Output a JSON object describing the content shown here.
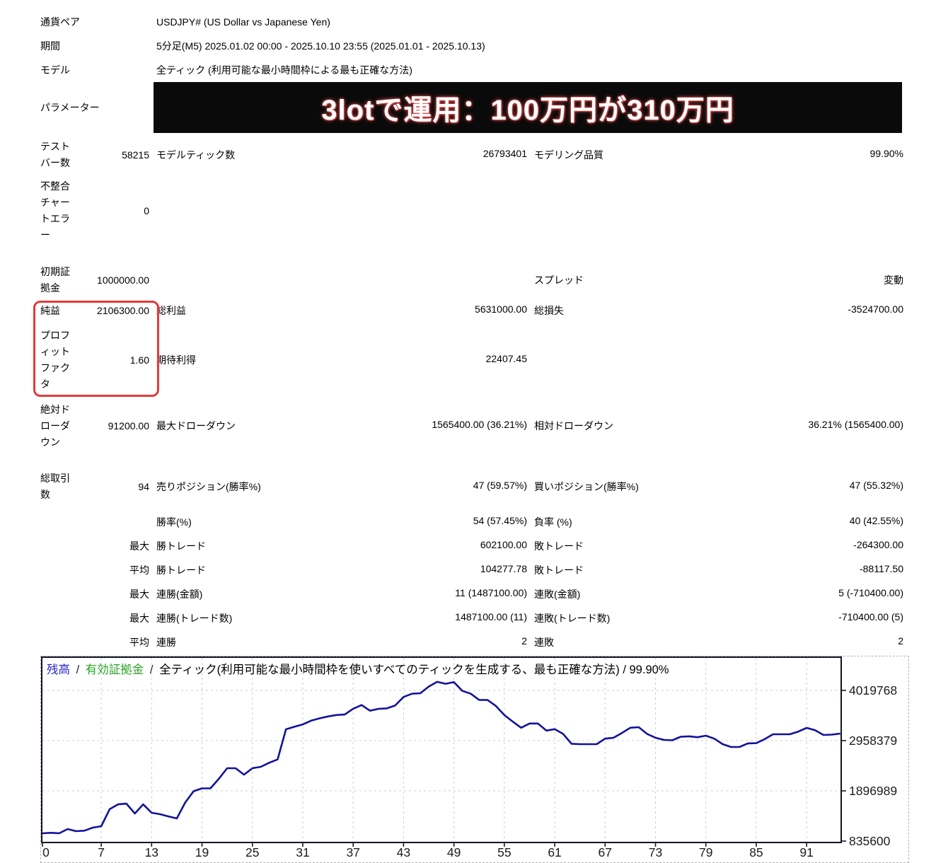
{
  "report": {
    "info_rows": [
      {
        "label": "通貨ペア",
        "value": "USDJPY# (US Dollar vs Japanese Yen)"
      },
      {
        "label": "期間",
        "value": "5分足(M5) 2025.01.02 00:00 - 2025.10.10 23:55 (2025.01.01 - 2025.10.13)"
      },
      {
        "label": "モデル",
        "value": "全ティック (利用可能な最小時間枠による最も正確な方法)"
      }
    ],
    "parameter_label": "パラメーター",
    "banner_text": "3lotで運用：100万円が310万円",
    "stat_rows": [
      {
        "c1": "テストバー数",
        "c2": "58215",
        "c3": "モデルティック数",
        "c4": "26793401",
        "c5": "モデリング品質",
        "c6": "99.90%"
      },
      {
        "c1": "不整合チャートエラー",
        "c2": "0",
        "c3": "",
        "c4": "",
        "c5": "",
        "c6": ""
      },
      {
        "c1": "初期証拠金",
        "c2": "1000000.00",
        "c3": "",
        "c4": "",
        "c5": "スプレッド",
        "c6": "変動"
      },
      {
        "c1": "純益",
        "c2": "2106300.00",
        "c3": "総利益",
        "c4": "5631000.00",
        "c5": "総損失",
        "c6": "-3524700.00"
      },
      {
        "c1": "プロフィットファクタ",
        "c2": "1.60",
        "c3": "期待利得",
        "c4": "22407.45",
        "c5": "",
        "c6": ""
      },
      {
        "c1": "絶対ドローダウン",
        "c2": "91200.00",
        "c3": "最大ドローダウン",
        "c4": "1565400.00 (36.21%)",
        "c5": "相対ドローダウン",
        "c6": "36.21% (1565400.00)"
      },
      {
        "c1": "総取引数",
        "c2": "94",
        "c3": "売りポジション(勝率%)",
        "c4": "47 (59.57%)",
        "c5": "買いポジション(勝率%)",
        "c6": "47 (55.32%)"
      },
      {
        "c1": "",
        "c2": "",
        "c3": "勝率(%)",
        "c4": "54 (57.45%)",
        "c5": "負率 (%)",
        "c6": "40 (42.55%)"
      },
      {
        "c1": "",
        "c2": "最大",
        "c3": "勝トレード",
        "c4": "602100.00",
        "c5": "敗トレード",
        "c6": "-264300.00"
      },
      {
        "c1": "",
        "c2": "平均",
        "c3": "勝トレード",
        "c4": "104277.78",
        "c5": "敗トレード",
        "c6": "-88117.50"
      },
      {
        "c1": "",
        "c2": "最大",
        "c3": "連勝(金額)",
        "c4": "11 (1487100.00)",
        "c5": "連敗(金額)",
        "c6": "5 (-710400.00)"
      },
      {
        "c1": "",
        "c2": "最大",
        "c3": "連勝(トレード数)",
        "c4": "1487100.00 (11)",
        "c5": "連敗(トレード数)",
        "c6": "-710400.00 (5)"
      },
      {
        "c1": "",
        "c2": "平均",
        "c3": "連勝",
        "c4": "2",
        "c5": "連敗",
        "c6": "2"
      }
    ]
  },
  "chart_data": {
    "type": "line",
    "legend_balance": "残高",
    "legend_equity": "有効証拠金",
    "separator": "/",
    "description": "全ティック(利用可能な最小時間枠を使いすべてのティックを生成する、最も正確な方法) / 99.90%",
    "xlabel": "",
    "ylabel": "",
    "x_ticks": [
      0,
      7,
      13,
      19,
      25,
      31,
      37,
      43,
      49,
      55,
      61,
      67,
      73,
      79,
      85,
      91
    ],
    "y_ticks": [
      4019768,
      2958379,
      1896989,
      835600
    ],
    "xlim": [
      0,
      95
    ],
    "ylim": [
      581000,
      4662000
    ],
    "grid": true,
    "legend_position": "top-left",
    "series": [
      {
        "name": "残高",
        "values": [
          1000000,
          1010000,
          1000000,
          1090000,
          1045000,
          1055000,
          1120000,
          1150000,
          1510000,
          1612000,
          1627000,
          1418000,
          1612000,
          1433000,
          1403000,
          1358000,
          1314000,
          1650000,
          1890000,
          1949000,
          1949000,
          2151000,
          2375000,
          2375000,
          2240000,
          2375000,
          2405000,
          2490000,
          2560000,
          3197000,
          3252000,
          3300000,
          3380000,
          3430000,
          3470000,
          3500000,
          3510000,
          3633000,
          3710000,
          3590000,
          3630000,
          3640000,
          3700000,
          3880000,
          3950000,
          3960000,
          4100000,
          4200000,
          4160000,
          4195000,
          4010000,
          3950000,
          3820000,
          3817000,
          3690000,
          3500000,
          3360000,
          3230000,
          3320000,
          3320000,
          3170000,
          3200000,
          3100000,
          2893000,
          2884000,
          2884000,
          2884000,
          3000000,
          3020000,
          3120000,
          3230000,
          3242000,
          3100000,
          3020000,
          2973000,
          2966000,
          3040000,
          3050000,
          3030000,
          3063000,
          3000000,
          2884000,
          2824000,
          2824000,
          2900000,
          2905000,
          2990000,
          3093000,
          3093000,
          3093000,
          3150000,
          3227000,
          3180000,
          3078000,
          3085000,
          3106300
        ]
      }
    ]
  },
  "colors": {
    "balance_line": "#12129b",
    "legend_balance": "#2626c9",
    "legend_equity": "#28a428",
    "grid_line": "#cccccc",
    "plot_border": "#131327",
    "red_box": "#e23b3b",
    "banner_bg": "#0a0a0a",
    "banner_text": "#ffffff",
    "banner_glow": "#e05050"
  }
}
